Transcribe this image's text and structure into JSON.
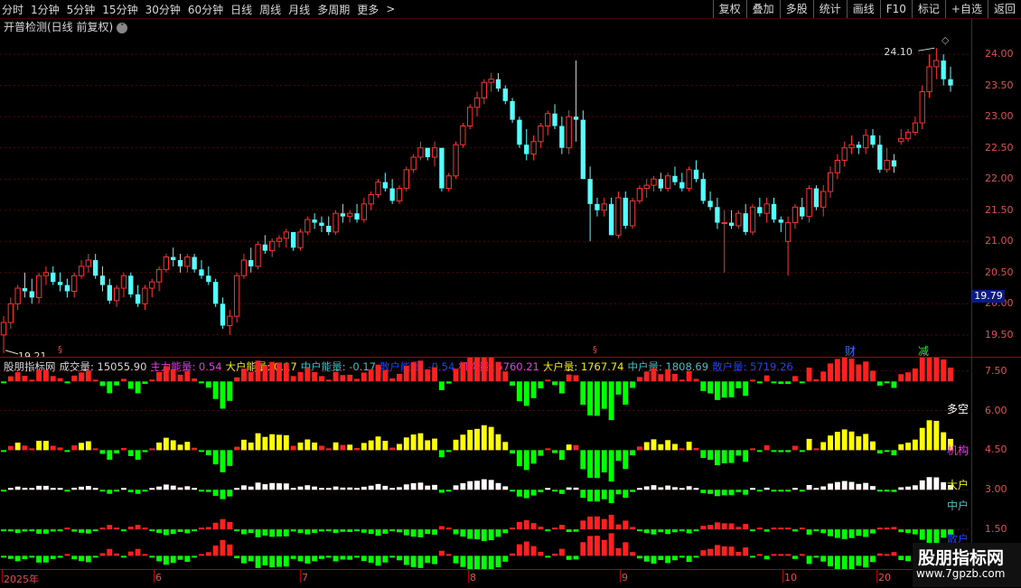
{
  "toolbar": {
    "periods": [
      "分时",
      "1分钟",
      "5分钟",
      "15分钟",
      "30分钟",
      "60分钟",
      "日线",
      "周线",
      "月线",
      "多周期",
      "更多"
    ],
    "more_arrow": ">",
    "actions": [
      "复权",
      "叠加",
      "多股",
      "统计",
      "画线",
      "F10",
      "标记",
      "+自选",
      "返回"
    ]
  },
  "main_panel": {
    "title": "开普检测(日线 前复权)",
    "dropdown_glyph": "˅",
    "y_ticks": [
      "24.00",
      "23.50",
      "23.00",
      "22.50",
      "22.00",
      "21.50",
      "21.00",
      "20.50",
      "20.00",
      "19.50"
    ],
    "y_range": [
      19.15,
      24.32
    ],
    "high_label": "24.10",
    "low_label": "19.21",
    "last_price_box": "19.79",
    "diamond_glyph": "◇",
    "marker_glyph": "§",
    "event_tags": [
      "财",
      "减"
    ]
  },
  "sub_panel": {
    "title_items": [
      {
        "text": "股朋指标网",
        "color": "#d8d8d8"
      },
      {
        "text": "成交量: 15055.90",
        "color": "#d8d8d8"
      },
      {
        "text": "主力能量: 0.54",
        "color": "#e040e0"
      },
      {
        "text": "大户能量: 0.17",
        "color": "#f0f000"
      },
      {
        "text": "中户能量: -0.17",
        "color": "#40c0c0"
      },
      {
        "text": "散户能量: -0.54",
        "color": "#2040ff"
      },
      {
        "text": "机构量: 5760.21",
        "color": "#e040e0"
      },
      {
        "text": "大户量: 1767.74",
        "color": "#f0f000"
      },
      {
        "text": "中户量: 1808.69",
        "color": "#40c0c0"
      },
      {
        "text": "散户量: 5719.26",
        "color": "#2040ff"
      }
    ],
    "y_ticks": [
      "7.50",
      "6.00",
      "4.50",
      "3.00",
      "1.50"
    ],
    "y_range": [
      0,
      8.0
    ],
    "row_labels": [
      {
        "text": "多空",
        "color": "#ffffff"
      },
      {
        "text": "机构",
        "color": "#e040e0"
      },
      {
        "text": "大户",
        "color": "#f0f000"
      },
      {
        "text": "中户",
        "color": "#40c0c0"
      },
      {
        "text": "散户",
        "color": "#2040ff"
      }
    ]
  },
  "x_axis": {
    "labels": [
      "2025年",
      "6",
      "7",
      "8",
      "9",
      "10",
      "20"
    ]
  },
  "watermark": {
    "line1": "股朋指标网",
    "line2": "www.7gpzb.com"
  },
  "colors": {
    "up": "#ff3232",
    "down": "#54ffff",
    "grid": "#5a0000",
    "axis": "#aa0000",
    "vol_up": "#ff2020",
    "vol_down": "#00ff00",
    "vol_strong": "#ffff00",
    "vol_white": "#ffffff"
  },
  "chart_data": {
    "type": "candlestick",
    "series": [
      {
        "name": "K",
        "candles": [
          [
            19.5,
            19.8,
            19.21,
            19.7
          ],
          [
            19.7,
            20.1,
            19.6,
            20.0
          ],
          [
            20.0,
            20.3,
            19.9,
            20.25
          ],
          [
            20.25,
            20.5,
            20.1,
            20.2
          ],
          [
            20.2,
            20.4,
            20.0,
            20.1
          ],
          [
            20.1,
            20.5,
            20.0,
            20.45
          ],
          [
            20.45,
            20.6,
            20.3,
            20.5
          ],
          [
            20.5,
            20.6,
            20.3,
            20.35
          ],
          [
            20.35,
            20.5,
            20.2,
            20.3
          ],
          [
            20.3,
            20.4,
            20.1,
            20.2
          ],
          [
            20.2,
            20.5,
            20.1,
            20.45
          ],
          [
            20.45,
            20.7,
            20.4,
            20.6
          ],
          [
            20.6,
            20.8,
            20.5,
            20.7
          ],
          [
            20.7,
            20.8,
            20.4,
            20.45
          ],
          [
            20.45,
            20.6,
            20.2,
            20.3
          ],
          [
            20.3,
            20.4,
            20.0,
            20.05
          ],
          [
            20.05,
            20.3,
            19.95,
            20.25
          ],
          [
            20.25,
            20.5,
            20.1,
            20.45
          ],
          [
            20.45,
            20.5,
            20.1,
            20.15
          ],
          [
            20.15,
            20.3,
            19.95,
            20.0
          ],
          [
            20.0,
            20.3,
            19.9,
            20.25
          ],
          [
            20.25,
            20.4,
            20.1,
            20.35
          ],
          [
            20.35,
            20.6,
            20.2,
            20.55
          ],
          [
            20.55,
            20.8,
            20.5,
            20.75
          ],
          [
            20.75,
            20.9,
            20.6,
            20.7
          ],
          [
            20.7,
            20.8,
            20.5,
            20.6
          ],
          [
            20.6,
            20.8,
            20.5,
            20.75
          ],
          [
            20.75,
            20.8,
            20.5,
            20.55
          ],
          [
            20.55,
            20.7,
            20.4,
            20.45
          ],
          [
            20.45,
            20.6,
            20.3,
            20.35
          ],
          [
            20.35,
            20.4,
            19.95,
            20.0
          ],
          [
            20.0,
            20.1,
            19.6,
            19.65
          ],
          [
            19.65,
            19.9,
            19.5,
            19.8
          ],
          [
            19.8,
            20.5,
            19.7,
            20.45
          ],
          [
            20.45,
            20.8,
            20.4,
            20.7
          ],
          [
            20.7,
            20.9,
            20.5,
            20.6
          ],
          [
            20.6,
            21.0,
            20.55,
            20.95
          ],
          [
            20.95,
            21.1,
            20.8,
            20.85
          ],
          [
            20.85,
            21.05,
            20.75,
            21.0
          ],
          [
            21.0,
            21.1,
            20.9,
            21.05
          ],
          [
            21.05,
            21.2,
            20.9,
            21.15
          ],
          [
            21.15,
            21.1,
            20.85,
            20.9
          ],
          [
            20.9,
            21.2,
            20.85,
            21.15
          ],
          [
            21.15,
            21.4,
            21.1,
            21.35
          ],
          [
            21.35,
            21.45,
            21.2,
            21.3
          ],
          [
            21.3,
            21.4,
            21.15,
            21.25
          ],
          [
            21.25,
            21.4,
            21.1,
            21.15
          ],
          [
            21.15,
            21.5,
            21.1,
            21.45
          ],
          [
            21.45,
            21.6,
            21.3,
            21.4
          ],
          [
            21.4,
            21.5,
            21.3,
            21.45
          ],
          [
            21.45,
            21.6,
            21.3,
            21.35
          ],
          [
            21.35,
            21.7,
            21.3,
            21.6
          ],
          [
            21.6,
            21.8,
            21.5,
            21.75
          ],
          [
            21.75,
            22.0,
            21.7,
            21.95
          ],
          [
            21.95,
            22.1,
            21.8,
            21.85
          ],
          [
            21.85,
            22.0,
            21.6,
            21.65
          ],
          [
            21.65,
            21.9,
            21.6,
            21.85
          ],
          [
            21.85,
            22.2,
            21.8,
            22.15
          ],
          [
            22.15,
            22.4,
            22.1,
            22.35
          ],
          [
            22.35,
            22.6,
            22.3,
            22.5
          ],
          [
            22.5,
            22.5,
            22.3,
            22.35
          ],
          [
            22.35,
            22.6,
            22.2,
            22.5
          ],
          [
            22.5,
            22.5,
            21.8,
            21.85
          ],
          [
            21.85,
            22.1,
            21.8,
            22.05
          ],
          [
            22.05,
            22.6,
            22.0,
            22.55
          ],
          [
            22.55,
            22.9,
            22.5,
            22.85
          ],
          [
            22.85,
            23.2,
            22.8,
            23.15
          ],
          [
            23.15,
            23.4,
            23.0,
            23.3
          ],
          [
            23.3,
            23.6,
            23.2,
            23.55
          ],
          [
            23.55,
            23.7,
            23.4,
            23.6
          ],
          [
            23.6,
            23.7,
            23.4,
            23.45
          ],
          [
            23.45,
            23.5,
            23.2,
            23.25
          ],
          [
            23.25,
            23.3,
            22.9,
            22.95
          ],
          [
            22.95,
            23.0,
            22.5,
            22.55
          ],
          [
            22.55,
            22.8,
            22.3,
            22.4
          ],
          [
            22.4,
            22.7,
            22.3,
            22.6
          ],
          [
            22.6,
            22.9,
            22.5,
            22.85
          ],
          [
            22.85,
            23.1,
            22.7,
            23.05
          ],
          [
            23.05,
            23.2,
            22.8,
            22.85
          ],
          [
            22.85,
            23.0,
            22.4,
            22.5
          ],
          [
            22.5,
            23.1,
            22.4,
            23.0
          ],
          [
            23.0,
            23.9,
            22.6,
            22.95
          ],
          [
            22.95,
            23.1,
            22.0,
            22.0
          ],
          [
            22.0,
            22.2,
            21.0,
            21.6
          ],
          [
            21.6,
            21.7,
            21.4,
            21.5
          ],
          [
            21.5,
            21.7,
            21.4,
            21.6
          ],
          [
            21.6,
            21.7,
            21.1,
            21.1
          ],
          [
            21.1,
            21.8,
            21.05,
            21.7
          ],
          [
            21.7,
            21.8,
            21.2,
            21.25
          ],
          [
            21.25,
            21.7,
            21.2,
            21.65
          ],
          [
            21.65,
            21.9,
            21.6,
            21.85
          ],
          [
            21.85,
            22.0,
            21.7,
            21.9
          ],
          [
            21.9,
            22.05,
            21.8,
            22.0
          ],
          [
            22.0,
            22.1,
            21.8,
            21.85
          ],
          [
            21.85,
            22.1,
            21.8,
            22.05
          ],
          [
            22.05,
            22.2,
            21.9,
            21.95
          ],
          [
            21.95,
            22.1,
            21.8,
            21.85
          ],
          [
            21.85,
            22.2,
            21.8,
            22.15
          ],
          [
            22.15,
            22.3,
            21.95,
            22.0
          ],
          [
            22.0,
            22.1,
            21.6,
            21.65
          ],
          [
            21.65,
            21.8,
            21.5,
            21.55
          ],
          [
            21.55,
            21.7,
            21.2,
            21.3
          ],
          [
            21.3,
            21.5,
            20.5,
            21.3
          ],
          [
            21.3,
            21.5,
            21.2,
            21.25
          ],
          [
            21.25,
            21.5,
            21.2,
            21.45
          ],
          [
            21.45,
            21.6,
            21.1,
            21.15
          ],
          [
            21.15,
            21.6,
            21.1,
            21.55
          ],
          [
            21.55,
            21.7,
            21.4,
            21.45
          ],
          [
            21.45,
            21.7,
            21.3,
            21.6
          ],
          [
            21.6,
            21.7,
            21.3,
            21.35
          ],
          [
            21.35,
            21.4,
            21.15,
            21.3
          ],
          [
            21.0,
            21.4,
            20.45,
            21.3
          ],
          [
            21.3,
            21.6,
            21.2,
            21.55
          ],
          [
            21.55,
            21.7,
            21.35,
            21.4
          ],
          [
            21.4,
            21.9,
            21.3,
            21.85
          ],
          [
            21.85,
            21.9,
            21.5,
            21.55
          ],
          [
            21.55,
            21.9,
            21.4,
            21.8
          ],
          [
            21.8,
            22.2,
            21.7,
            22.1
          ],
          [
            22.1,
            22.4,
            22.0,
            22.3
          ],
          [
            22.3,
            22.6,
            22.2,
            22.5
          ],
          [
            22.5,
            22.7,
            22.4,
            22.55
          ],
          [
            22.55,
            22.6,
            22.4,
            22.5
          ],
          [
            22.5,
            22.8,
            22.4,
            22.7
          ],
          [
            22.7,
            22.8,
            22.5,
            22.55
          ],
          [
            22.55,
            22.7,
            22.1,
            22.15
          ],
          [
            22.15,
            22.5,
            22.1,
            22.3
          ],
          [
            22.3,
            22.4,
            22.1,
            22.2
          ],
          [
            22.6,
            22.8,
            22.55,
            22.65
          ],
          [
            22.65,
            22.8,
            22.6,
            22.75
          ],
          [
            22.75,
            23.0,
            22.7,
            22.9
          ],
          [
            22.9,
            23.5,
            22.8,
            23.4
          ],
          [
            23.4,
            24.0,
            23.3,
            23.8
          ],
          [
            23.8,
            24.1,
            23.6,
            23.9
          ],
          [
            23.9,
            24.0,
            23.5,
            23.6
          ],
          [
            23.6,
            23.8,
            23.4,
            23.5
          ]
        ]
      }
    ],
    "indicator_rows": [
      {
        "name": "多空",
        "base": 7.1
      },
      {
        "name": "机构",
        "base": 4.5
      },
      {
        "name": "大户",
        "base": 3.0
      },
      {
        "name": "中户",
        "base": 1.5
      },
      {
        "name": "散户",
        "base": 0.5
      }
    ]
  }
}
